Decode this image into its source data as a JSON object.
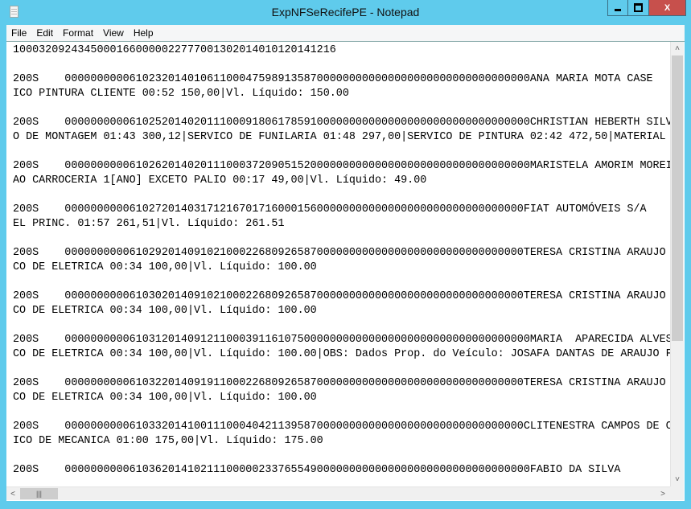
{
  "window": {
    "title": "ExpNFSeRecifePE - Notepad",
    "close_label": "X",
    "accent_color": "#5fcbec",
    "close_color": "#c7504c"
  },
  "menu": [
    "File",
    "Edit",
    "Format",
    "View",
    "Help"
  ],
  "document": {
    "lines": [
      "10003209243450001660000022777001302014010120141216",
      "",
      "200S    000000000061023201401061100047598913587000000000000000000000000000000000ANA MARIA MOTA CASE",
      "ICO PINTURA CLIENTE 00:52 150,00|Vl. Líquido: 150.00",
      "",
      "200S    000000000061025201402011100091806178591000000000000000000000000000000000CHRISTIAN HEBERTH SILVA",
      "O DE MONTAGEM 01:43 300,12|SERVICO DE FUNILARIA 01:48 297,00|SERVICO DE PINTURA 02:42 472,50|MATERIAL",
      "",
      "200S    000000000061026201402011100037209051520000000000000000000000000000000000MARISTELA AMORIM MOREIRA",
      "AO CARROCERIA 1[ANO] EXCETO PALIO 00:17 49,00|Vl. Líquido: 49.00",
      "",
      "200S    00000000006102720140317121670171600015600000000000000000000000000000000FIAT AUTOMÓVEIS S/A",
      "EL PRINC. 01:57 261,51|Vl. Líquido: 261.51",
      "",
      "200S    00000000006102920140910210002268092658700000000000000000000000000000000TERESA CRISTINA ARAUJO SC",
      "CO DE ELETRICA 00:34 100,00|Vl. Líquido: 100.00",
      "",
      "200S    00000000006103020140910210002268092658700000000000000000000000000000000TERESA CRISTINA ARAUJO SC",
      "CO DE ELETRICA 00:34 100,00|Vl. Líquido: 100.00",
      "",
      "200S    000000000061031201409121100039116107500000000000000000000000000000000000MARIA  APARECIDA ALVES DC",
      "CO DE ELETRICA 00:34 100,00|Vl. Líquido: 100.00|OBS: Dados Prop. do Veículo: JOSAFA DANTAS DE ARAUJO F",
      "",
      "200S    00000000006103220140919110002268092658700000000000000000000000000000000TERESA CRISTINA ARAUJO SC",
      "CO DE ELETRICA 00:34 100,00|Vl. Líquido: 100.00",
      "",
      "200S    00000000006103320141001110004042113958700000000000000000000000000000000CLITENESTRA CAMPOS DE CAF",
      "ICO DE MECANICA 01:00 175,00|Vl. Líquido: 175.00",
      "",
      "200S    000000000061036201410211100000233765549000000000000000000000000000000000FABIO DA SILVA"
    ]
  },
  "icons": {
    "app": "notepad-icon",
    "minimize": "minimize-icon",
    "maximize": "maximize-icon",
    "scroll_up": "chevron-up-icon",
    "scroll_down": "chevron-down-icon",
    "scroll_left": "chevron-left-icon",
    "scroll_right": "chevron-right-icon"
  }
}
